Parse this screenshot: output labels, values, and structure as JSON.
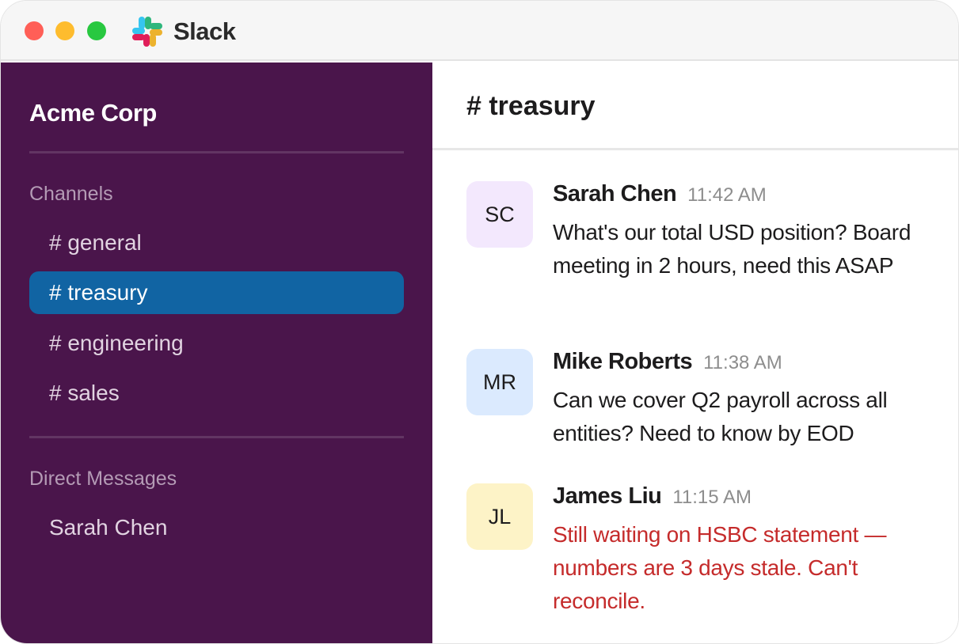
{
  "app": {
    "name": "Slack",
    "logo_icon": "slack-logo-icon",
    "brand_colors": [
      "#36c5f0",
      "#2eb67d",
      "#ecb22e",
      "#e01e5a"
    ]
  },
  "window_controls": {
    "close_color": "#ff5f57",
    "minimize_color": "#febc2e",
    "maximize_color": "#28c840"
  },
  "sidebar": {
    "workspace_name": "Acme Corp",
    "background": "#4a154b",
    "channels_label": "Channels",
    "channels": [
      {
        "label": "# general",
        "active": false
      },
      {
        "label": "# treasury",
        "active": true
      },
      {
        "label": "# engineering",
        "active": false
      },
      {
        "label": "# sales",
        "active": false
      }
    ],
    "active_color": "#1164a3",
    "dm_label": "Direct Messages",
    "direct_messages": [
      {
        "label": "Sarah Chen"
      }
    ]
  },
  "channel": {
    "title": "# treasury"
  },
  "messages": [
    {
      "initials": "SC",
      "avatar_color": "#f3e8fd",
      "author": "Sarah Chen",
      "time": "11:42 AM",
      "text": "What's our total USD position? Board meeting in 2 hours, need this ASAP",
      "alert": false
    },
    {
      "initials": "MR",
      "avatar_color": "#dbeafe",
      "author": "Mike Roberts",
      "time": "11:38 AM",
      "text": "Can we cover Q2 payroll across all entities? Need to know by EOD",
      "alert": false
    },
    {
      "initials": "JL",
      "avatar_color": "#fdf3c7",
      "author": "James Liu",
      "time": "11:15 AM",
      "text": "Still waiting on HSBC statement — numbers are 3 days stale. Can't reconcile.",
      "alert": true,
      "alert_color": "#c52b2b"
    }
  ]
}
